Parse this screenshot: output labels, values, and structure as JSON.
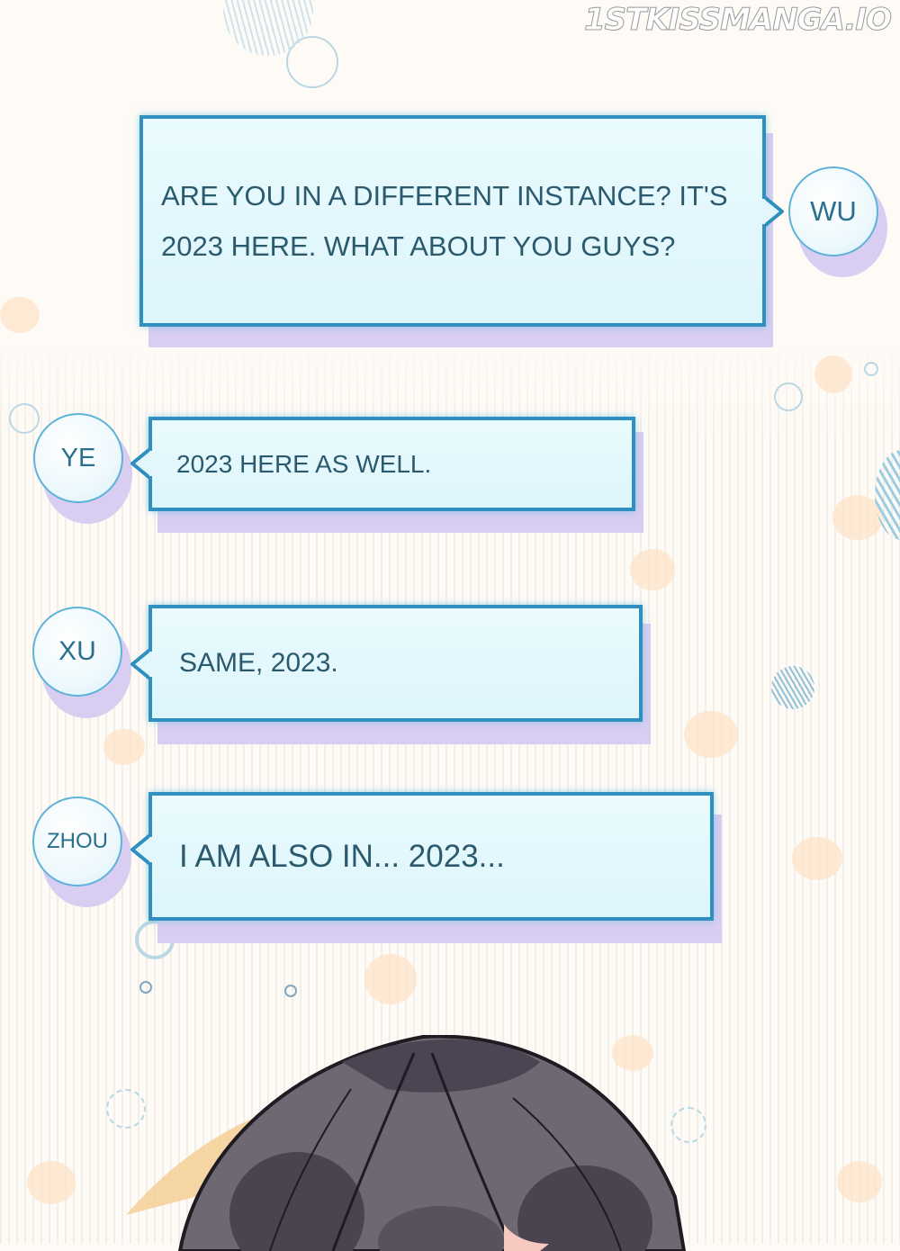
{
  "watermark": "1STKISSMANGA.IO",
  "messages": [
    {
      "speaker": "WU",
      "text": "ARE YOU IN A DIFFERENT INSTANCE? IT'S\n2023 HERE. WHAT ABOUT YOU GUYS?"
    },
    {
      "speaker": "YE",
      "text": "2023 HERE AS WELL."
    },
    {
      "speaker": "XU",
      "text": "SAME, 2023."
    },
    {
      "speaker": "ZHOU",
      "text": "I AM ALSO IN... 2023..."
    }
  ],
  "colors": {
    "bubble_border": "#2f8fbf",
    "bubble_fill": "#e4f8fc",
    "bubble_shadow": "#d9cdf1",
    "text": "#2b5a6e"
  }
}
